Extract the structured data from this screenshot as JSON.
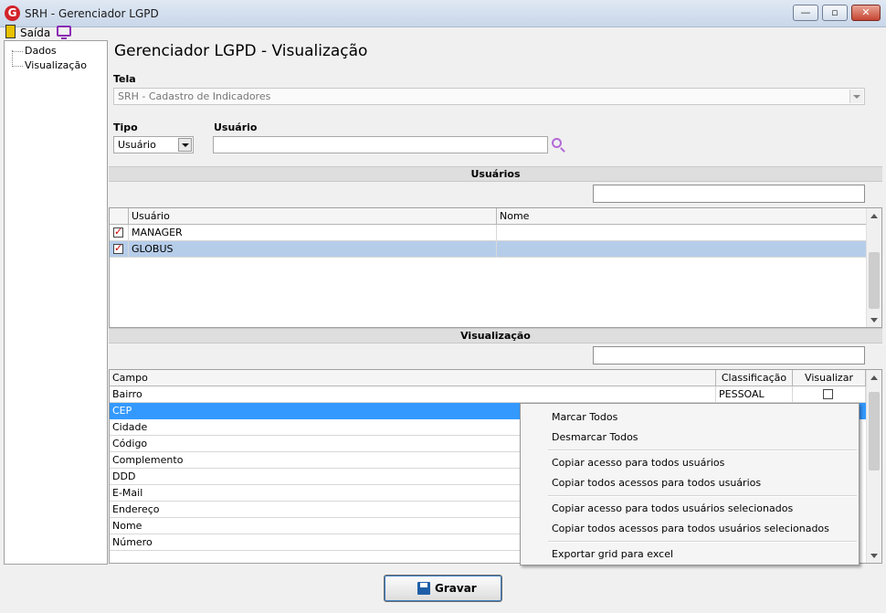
{
  "window": {
    "logo_text": "G",
    "title": "SRH - Gerenciador LGPD",
    "btn_min": "—",
    "btn_max": "▫",
    "btn_close": "✕"
  },
  "toolbar": {
    "exit_label": "Saída"
  },
  "tree": {
    "items": [
      {
        "label": "Dados"
      },
      {
        "label": "Visualização"
      }
    ]
  },
  "page": {
    "title": "Gerenciador LGPD - Visualização"
  },
  "form": {
    "tela_label": "Tela",
    "tela_value": "SRH - Cadastro de Indicadores",
    "tipo_label": "Tipo",
    "tipo_value": "Usuário",
    "usuario_label": "Usuário",
    "usuario_value": ""
  },
  "usuarios": {
    "section_title": "Usuários",
    "search_value": "",
    "columns": [
      "Usuário",
      "Nome"
    ],
    "rows": [
      {
        "checked": true,
        "usuario": "MANAGER",
        "nome": ""
      },
      {
        "checked": true,
        "usuario": "GLOBUS",
        "nome": ""
      }
    ]
  },
  "visualizacao": {
    "section_title": "Visualização",
    "search_value": "",
    "columns": [
      "Campo",
      "Classificação",
      "Visualizar"
    ],
    "rows": [
      {
        "campo": "Bairro",
        "classificacao": "PESSOAL",
        "visualizar": false
      },
      {
        "campo": "CEP"
      },
      {
        "campo": "Cidade"
      },
      {
        "campo": "Código"
      },
      {
        "campo": "Complemento"
      },
      {
        "campo": "DDD"
      },
      {
        "campo": "E-Mail"
      },
      {
        "campo": "Endereço"
      },
      {
        "campo": "Nome"
      },
      {
        "campo": "Número"
      }
    ]
  },
  "context_menu": {
    "items": [
      "Marcar Todos",
      "Desmarcar Todos",
      "Copiar acesso para todos usuários",
      "Copiar todos acessos para todos usuários",
      "Copiar acesso para todos usuários selecionados",
      "Copiar todos acessos para todos usuários selecionados",
      "Exportar grid para excel"
    ]
  },
  "footer": {
    "save_label": "Gravar"
  },
  "colors": {
    "accent": "#3399ff",
    "row_selected": "#b6cdea",
    "search_icon_purple": "#b36bd6",
    "logo_red": "#d2232a"
  },
  "icons": {
    "search": "search-icon",
    "exit": "exit-door-icon",
    "monitor": "monitor-icon",
    "save": "floppy-disk-icon"
  }
}
